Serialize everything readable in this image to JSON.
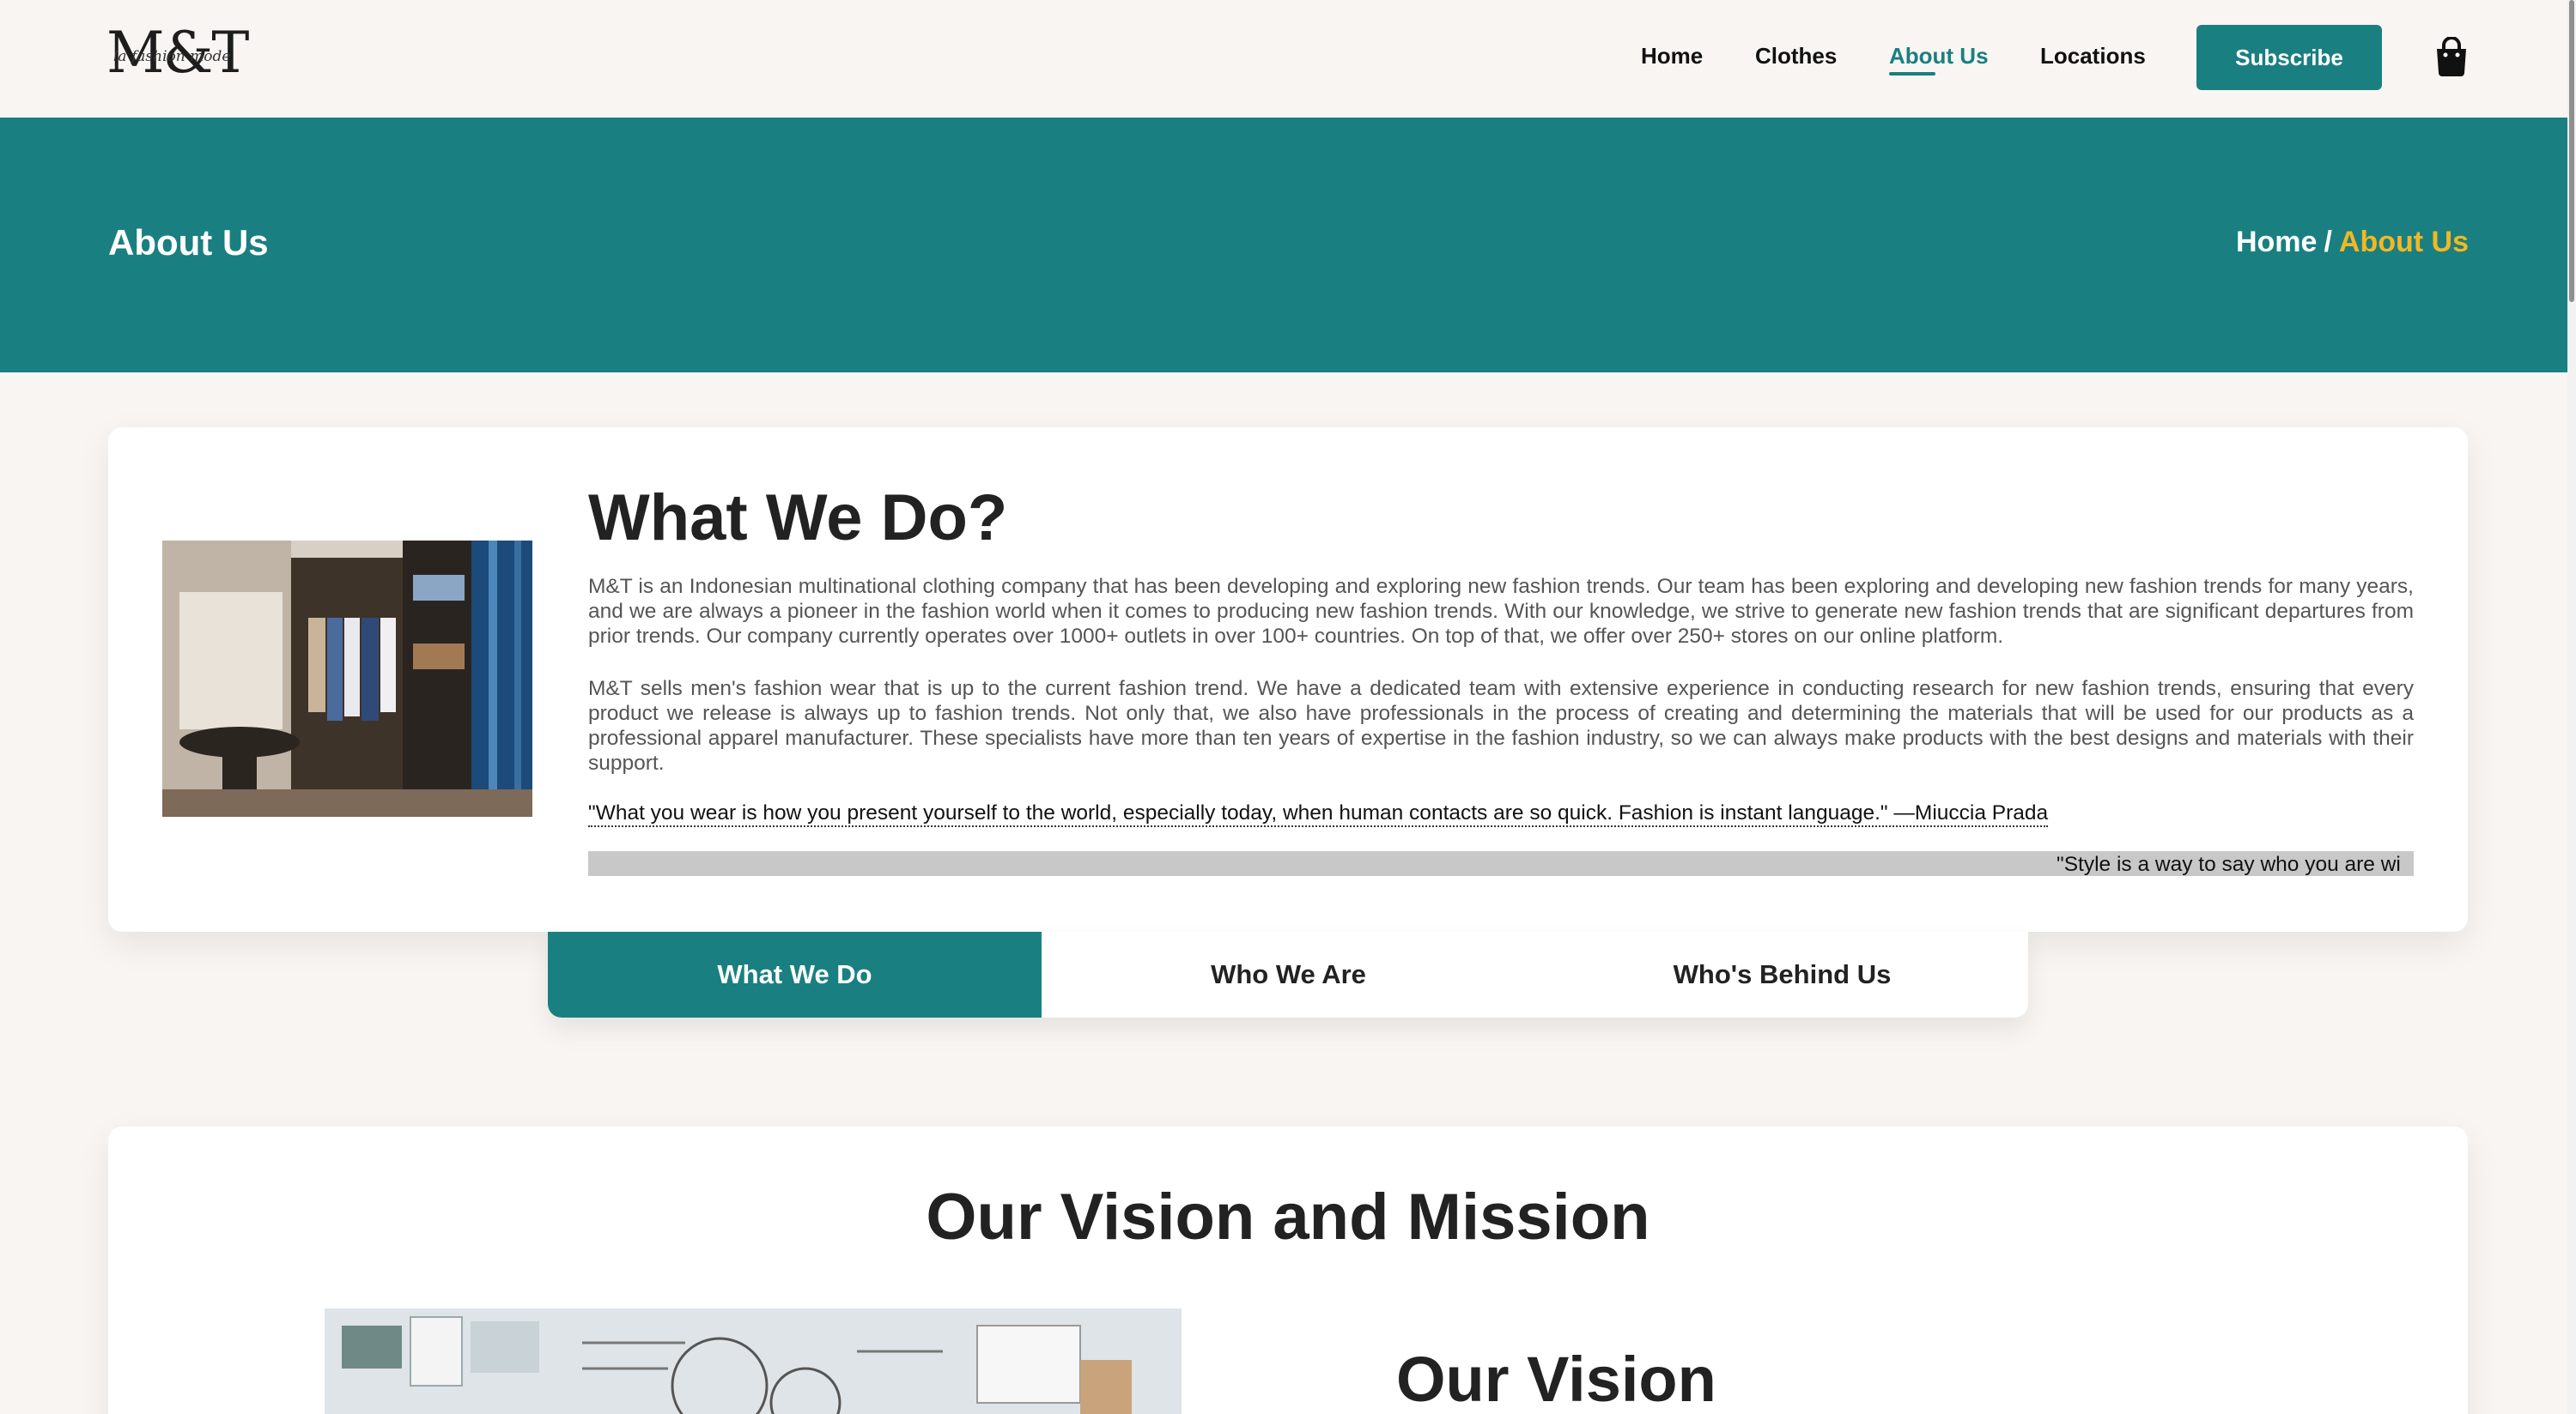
{
  "brand": {
    "logo_text": "M&T",
    "logo_tagline": "la fashion mode"
  },
  "nav": {
    "items": [
      {
        "label": "Home"
      },
      {
        "label": "Clothes"
      },
      {
        "label": "About Us"
      },
      {
        "label": "Locations"
      }
    ],
    "active_item": "About Us",
    "subscribe_label": "Subscribe"
  },
  "hero": {
    "title": "About Us",
    "breadcrumb_home": "Home",
    "breadcrumb_sep": "/",
    "breadcrumb_current": "About Us"
  },
  "about": {
    "heading": "What We Do?",
    "paragraph_1": "M&T is an Indonesian multinational clothing company that has been developing and exploring new fashion trends. Our team has been exploring and developing new fashion trends for many years, and we are always a pioneer in the fashion world when it comes to producing new fashion trends. With our knowledge, we strive to generate new fashion trends that are significant departures from prior trends. Our company currently operates over 1000+ outlets in over 100+ countries. On top of that, we offer over 250+ stores on our online platform.",
    "paragraph_2": "M&T sells men's fashion wear that is up to the current fashion trend. We have a dedicated team with extensive experience in conducting research for new fashion trends, ensuring that every product we release is always up to fashion trends. Not only that, we also have professionals in the process of creating and determining the materials that will be used for our products as a professional apparel manufacturer. These specialists have more than ten years of expertise in the fashion industry, so we can always make products with the best designs and materials with their support.",
    "quote": "\"What you wear is how you present yourself to the world, especially today, when human contacts are so quick. Fashion is instant language.\" —Miuccia Prada",
    "marquee": "\"Style is a way to say who you are wi"
  },
  "tabs": [
    {
      "label": "What We Do",
      "active": true
    },
    {
      "label": "Who We Are",
      "active": false
    },
    {
      "label": "Who's Behind Us",
      "active": false
    }
  ],
  "vision": {
    "heading": "Our Vision and Mission",
    "subheading": "Our Vision"
  },
  "colors": {
    "accent": "#1a7f81",
    "highlight": "#f2b824",
    "background": "#f8f5f2"
  }
}
